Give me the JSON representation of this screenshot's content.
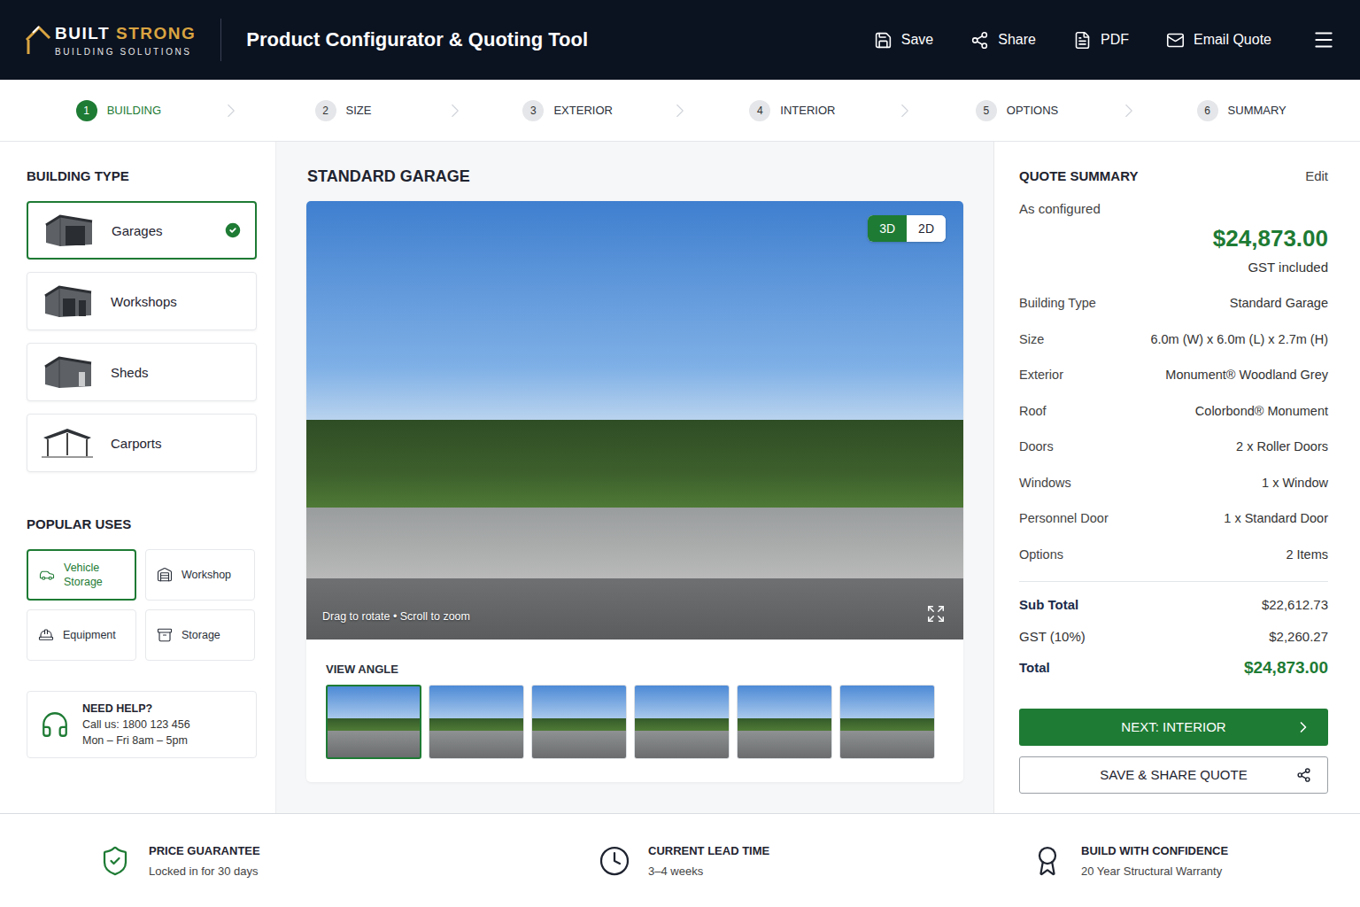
{
  "header": {
    "logo": {
      "first": "BUILT",
      "second": "STRONG",
      "tagline": "BUILDING SOLUTIONS"
    },
    "title": "Product Configurator & Quoting Tool",
    "actions": [
      {
        "label": "Save"
      },
      {
        "label": "Share"
      },
      {
        "label": "PDF"
      },
      {
        "label": "Email Quote"
      }
    ]
  },
  "steps": [
    {
      "number": "1",
      "label": "BUILDING",
      "selected": true
    },
    {
      "number": "2",
      "label": "SIZE",
      "selected": false
    },
    {
      "number": "3",
      "label": "EXTERIOR",
      "selected": false
    },
    {
      "number": "4",
      "label": "INTERIOR",
      "selected": false
    },
    {
      "number": "5",
      "label": "OPTIONS",
      "selected": false
    },
    {
      "number": "6",
      "label": "SUMMARY",
      "selected": false
    }
  ],
  "sidebar": {
    "building_type": {
      "heading": "BUILDING TYPE",
      "items": [
        {
          "label": "Garages",
          "selected": true
        },
        {
          "label": "Workshops",
          "selected": false
        },
        {
          "label": "Sheds",
          "selected": false
        },
        {
          "label": "Carports",
          "selected": false
        }
      ]
    },
    "popular_uses": {
      "heading": "POPULAR USES",
      "items": [
        {
          "label": "Vehicle Storage",
          "selected": true
        },
        {
          "label": "Workshop",
          "selected": false
        },
        {
          "label": "Equipment",
          "selected": false
        },
        {
          "label": "Storage",
          "selected": false
        }
      ]
    },
    "help": {
      "title": "NEED HELP?",
      "phone": "Call us: 1800 123 456",
      "hours": "Mon – Fri 8am – 5pm"
    }
  },
  "preview": {
    "title": "STANDARD GARAGE",
    "view_modes": [
      {
        "label": "3D",
        "selected": true
      },
      {
        "label": "2D",
        "selected": false
      }
    ],
    "hint": "Drag to rotate • Scroll to zoom",
    "view_angle": {
      "heading": "VIEW ANGLE",
      "thumbnails": [
        {
          "selected": true
        },
        {
          "selected": false
        },
        {
          "selected": false
        },
        {
          "selected": false
        },
        {
          "selected": false
        },
        {
          "selected": false
        }
      ]
    }
  },
  "quote": {
    "heading": "QUOTE SUMMARY",
    "edit": "Edit",
    "caption": "As configured",
    "price": "$24,873.00",
    "price_note": "GST included",
    "rows": [
      {
        "label": "Building Type",
        "value": "Standard Garage"
      },
      {
        "label": "Size",
        "value": "6.0m (W) x 6.0m (L) x 2.7m (H)"
      },
      {
        "label": "Exterior",
        "value": "Monument® Woodland Grey"
      },
      {
        "label": "Roof",
        "value": "Colorbond® Monument"
      },
      {
        "label": "Doors",
        "value": "2 x Roller Doors"
      },
      {
        "label": "Windows",
        "value": "1 x Window"
      },
      {
        "label": "Personnel Door",
        "value": "1 x Standard Door"
      },
      {
        "label": "Options",
        "value": "2 Items"
      }
    ],
    "totals": [
      {
        "label": "Sub Total",
        "value": "$22,612.73",
        "kind": "subtotal"
      },
      {
        "label": "GST (10%)",
        "value": "$2,260.27",
        "kind": "tax"
      },
      {
        "label": "Total",
        "value": "$24,873.00",
        "kind": "total"
      }
    ],
    "primary_button": "NEXT: INTERIOR",
    "secondary_button": "SAVE & SHARE QUOTE"
  },
  "footer": [
    {
      "title": "PRICE GUARANTEE",
      "subtitle": "Locked in for 30 days"
    },
    {
      "title": "CURRENT LEAD TIME",
      "subtitle": "3–4 weeks"
    },
    {
      "title": "BUILD WITH CONFIDENCE",
      "subtitle": "20 Year Structural Warranty"
    }
  ]
}
